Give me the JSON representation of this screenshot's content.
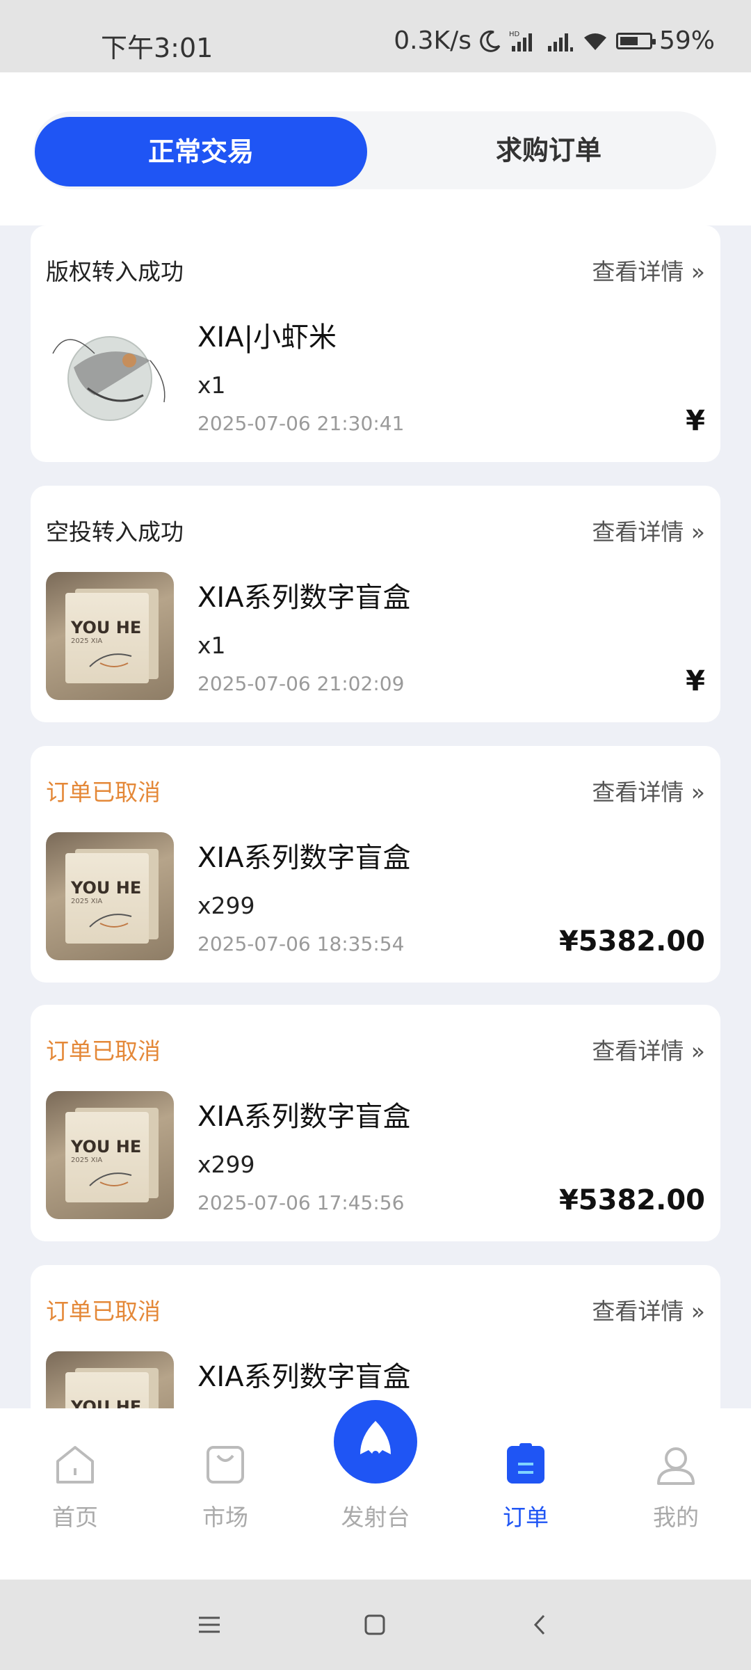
{
  "status_bar": {
    "time": "下午3:01",
    "net_speed": "0.3K/s",
    "battery": "59%"
  },
  "tabs": {
    "active": "正常交易",
    "inactive": "求购订单"
  },
  "detail_label": "查看详情",
  "orders": [
    {
      "status": "版权转入成功",
      "status_type": "success",
      "name": "XIA|小虾米",
      "qty": "x1",
      "date": "2025-07-06 21:30:41",
      "price": "¥",
      "image": "shrimp-art"
    },
    {
      "status": "空投转入成功",
      "status_type": "success",
      "name": "XIA系列数字盲盒",
      "qty": "x1",
      "date": "2025-07-06 21:02:09",
      "price": "¥",
      "image": "youhe-box"
    },
    {
      "status": "订单已取消",
      "status_type": "cancel",
      "name": "XIA系列数字盲盒",
      "qty": "x299",
      "date": "2025-07-06 18:35:54",
      "price": "¥5382.00",
      "image": "youhe-box"
    },
    {
      "status": "订单已取消",
      "status_type": "cancel",
      "name": "XIA系列数字盲盒",
      "qty": "x299",
      "date": "2025-07-06 17:45:56",
      "price": "¥5382.00",
      "image": "youhe-box"
    },
    {
      "status": "订单已取消",
      "status_type": "cancel",
      "name": "XIA系列数字盲盒",
      "qty": "",
      "date": "",
      "price": "",
      "image": "youhe-box"
    }
  ],
  "box_text": {
    "brand": "YOU HE",
    "sub": "2025 XIA"
  },
  "nav": {
    "home": "首页",
    "market": "市场",
    "launch": "发射台",
    "orders": "订单",
    "mine": "我的"
  },
  "colors": {
    "accent": "#1f55f4",
    "cancel": "#e48838"
  }
}
